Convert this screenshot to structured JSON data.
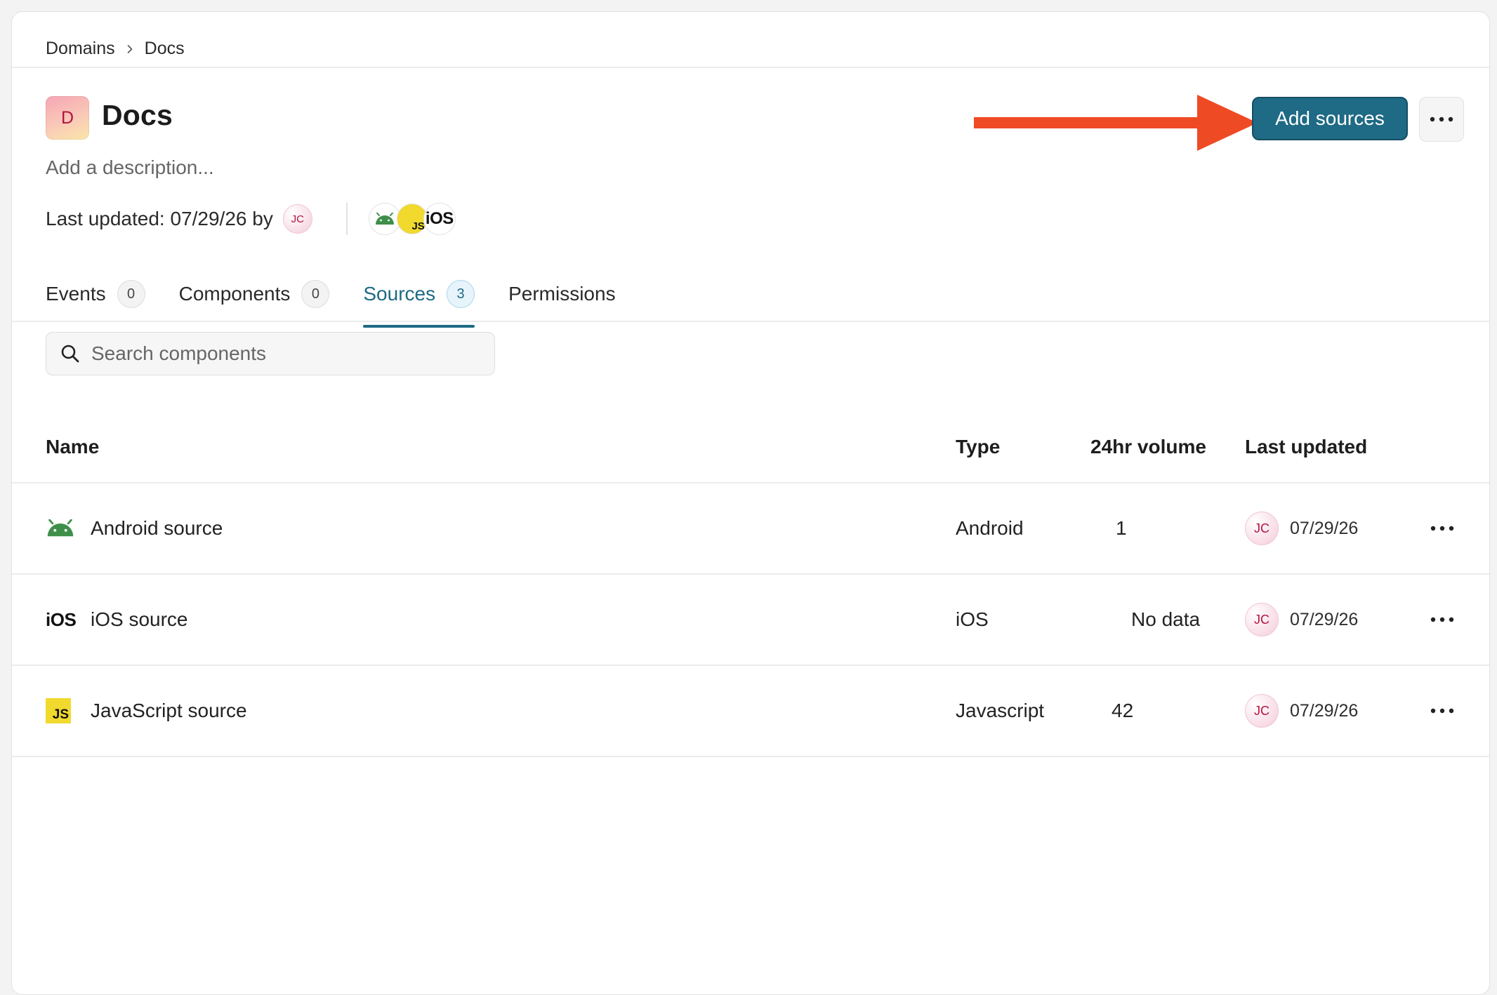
{
  "breadcrumb": {
    "root": "Domains",
    "current": "Docs"
  },
  "header": {
    "avatar_letter": "D",
    "title": "Docs",
    "description_placeholder": "Add a description...",
    "last_updated_text": "Last updated: 07/29/26 by",
    "updated_by_initials": "JC",
    "platform_icons": [
      "android-icon",
      "javascript-icon",
      "ios-icon"
    ],
    "platform_js_label": "JS",
    "platform_ios_label": "iOS",
    "add_sources_label": "Add sources",
    "more_icon": "ellipsis-icon"
  },
  "tabs": [
    {
      "label": "Events",
      "count": "0",
      "active": false
    },
    {
      "label": "Components",
      "count": "0",
      "active": false
    },
    {
      "label": "Sources",
      "count": "3",
      "active": true
    },
    {
      "label": "Permissions",
      "active": false
    }
  ],
  "search": {
    "placeholder": "Search components",
    "value": ""
  },
  "table": {
    "columns": {
      "name": "Name",
      "type": "Type",
      "volume": "24hr volume",
      "updated": "Last updated"
    },
    "rows": [
      {
        "icon": "android-icon",
        "name": "Android source",
        "type": "Android",
        "volume": "1",
        "updated_by": "JC",
        "updated": "07/29/26"
      },
      {
        "icon": "ios-icon",
        "icon_text": "iOS",
        "name": "iOS source",
        "type": "iOS",
        "volume": "No data",
        "updated_by": "JC",
        "updated": "07/29/26"
      },
      {
        "icon": "javascript-icon",
        "icon_text": "JS",
        "name": "JavaScript source",
        "type": "Javascript",
        "volume": "42",
        "updated_by": "JC",
        "updated": "07/29/26"
      }
    ]
  },
  "colors": {
    "accent": "#1f6a85",
    "annotation_arrow": "#ee4a24",
    "android_green": "#3ddc84",
    "js_yellow": "#f1d92e",
    "avatar_text": "#b3123f"
  }
}
